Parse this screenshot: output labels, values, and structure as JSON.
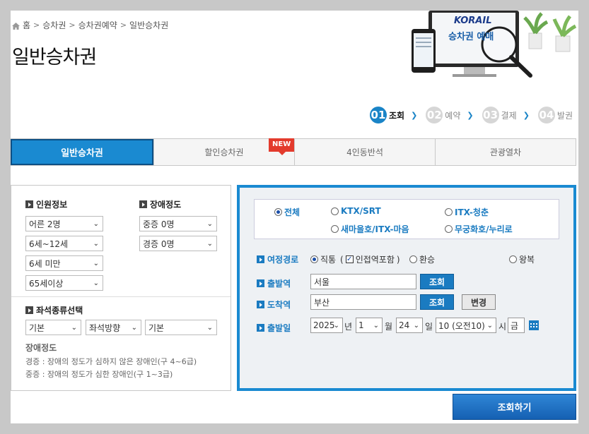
{
  "breadcrumb": {
    "items": [
      "홈",
      "승차권",
      "승차권예약",
      "일반승차권"
    ]
  },
  "page_title": "일반승차권",
  "banner": {
    "logo": "KORAIL",
    "caption": "승차권 예매"
  },
  "steps": [
    {
      "num": "01",
      "label": "조회"
    },
    {
      "num": "02",
      "label": "예약"
    },
    {
      "num": "03",
      "label": "결제"
    },
    {
      "num": "04",
      "label": "발권"
    }
  ],
  "tabs": [
    "일반승차권",
    "할인승차권",
    "4인동반석",
    "관광열차"
  ],
  "new_badge": "NEW",
  "passenger": {
    "title": "인원정보",
    "selects": [
      "어른 2명",
      "6세~12세",
      "6세 미만",
      "65세이상"
    ]
  },
  "disability": {
    "title": "장애정도",
    "selects": [
      "중증 0명",
      "경증 0명"
    ]
  },
  "seat": {
    "title": "좌석종류선택",
    "selects": [
      "기본",
      "좌석방향",
      "기본"
    ]
  },
  "legend": {
    "title": "장애정도",
    "lines": [
      "경증 : 장애의 정도가 심하지 않은 장애인(구 4~6급)",
      "중증 : 장애의 정도가 심한 장애인(구 1~3급)"
    ]
  },
  "train_types": [
    "전체",
    "KTX/SRT",
    "ITX-청춘",
    "새마을호/ITX-마음",
    "무궁화호/누리로"
  ],
  "route": {
    "label": "여정경로",
    "direct": "직통",
    "nearby": "인접역포함",
    "transfer": "환승",
    "round": "왕복"
  },
  "departure": {
    "label": "출발역",
    "value": "서울",
    "button": "조회"
  },
  "arrival": {
    "label": "도착역",
    "value": "부산",
    "button": "조회",
    "swap": "변경"
  },
  "date": {
    "label": "출발일",
    "year": "2025",
    "year_unit": "년",
    "month": "1",
    "month_unit": "월",
    "day": "24",
    "day_unit": "일",
    "hour": "10 (오전10)",
    "hour_unit": "시",
    "weekday": "금"
  },
  "submit": "조회하기",
  "colors": {
    "accent": "#1a8ad1",
    "new": "#e33b2d"
  }
}
